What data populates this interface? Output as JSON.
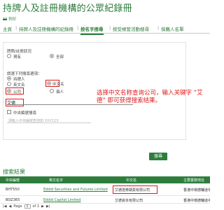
{
  "header": {
    "title": "持牌人及註冊機構的公眾紀錄冊",
    "print_label": "列印"
  },
  "tabs": [
    {
      "label": "主頁"
    },
    {
      "label": "持牌人及註冊機構的紀錄冊"
    },
    {
      "label": "按名字搜尋"
    },
    {
      "label": "按受規管活動搜尋"
    },
    {
      "label": "保薦人名單"
    }
  ],
  "form": {
    "status_label": "牌照/註冊狀況",
    "status_options": [
      "現有",
      "全部"
    ],
    "status_selected": "全部",
    "type_label": "請選下列搜尋選項：",
    "type_options": [
      "持牌人",
      "英文名",
      "中文名",
      "公司",
      "個人"
    ],
    "name_options_selected": "中文名",
    "entity_selected": "公司",
    "search_value": "艾德",
    "checkbox_label": "中央編號搜尋",
    "ce_placeholder": "請輸入中央編號查詢如 XXX123",
    "search_button": "搜尋"
  },
  "annotation": "选择中文名称查询公司，输入关键字 “艾德” 即可获得搜索结果。",
  "results": {
    "title": "搜索結果",
    "columns": [
      "中央編號",
      "英文名字",
      "中文名",
      "主要業務地址"
    ],
    "rows": [
      {
        "ce": "BHT550",
        "en": "Eddid Securities and Futures Limited",
        "zh": "艾德證券期貨有限公司",
        "addr": "香港中環德輔道中..."
      },
      {
        "ce": "BOZ365",
        "en": "Eddid Capital Limited",
        "zh": "艾德資本有限公司",
        "addr": "香港中環德輔道中..."
      }
    ]
  },
  "pager": {
    "page_label": "Page",
    "page": "1",
    "of_label": "of 1"
  }
}
